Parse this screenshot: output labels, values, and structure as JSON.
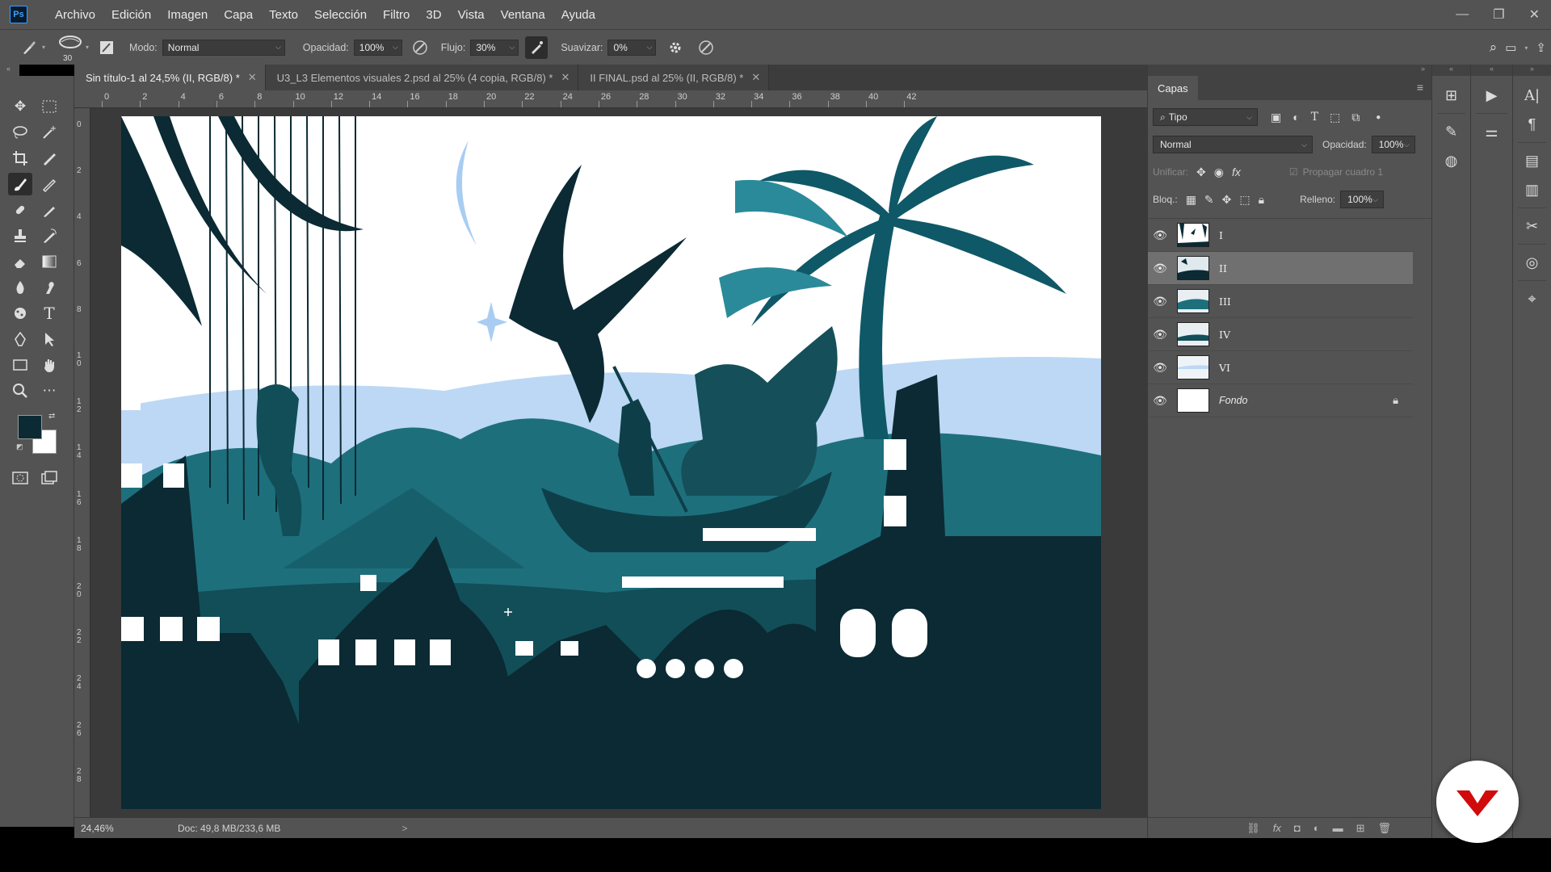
{
  "app": {
    "logo": "Ps"
  },
  "menu": [
    "Archivo",
    "Edición",
    "Imagen",
    "Capa",
    "Texto",
    "Selección",
    "Filtro",
    "3D",
    "Vista",
    "Ventana",
    "Ayuda"
  ],
  "options": {
    "brush_size": "30",
    "mode_label": "Modo:",
    "mode_value": "Normal",
    "opacity_label": "Opacidad:",
    "opacity_value": "100%",
    "flow_label": "Flujo:",
    "flow_value": "30%",
    "smooth_label": "Suavizar:",
    "smooth_value": "0%"
  },
  "tabs": [
    {
      "label": "Sin título-1 al 24,5% (II, RGB/8) *",
      "active": true
    },
    {
      "label": "U3_L3 Elementos visuales 2.psd al 25% (4 copia, RGB/8) *",
      "active": false
    },
    {
      "label": "II FINAL.psd al 25% (II, RGB/8) *",
      "active": false
    }
  ],
  "ruler_h": [
    "0",
    "2",
    "4",
    "6",
    "8",
    "10",
    "12",
    "14",
    "16",
    "18",
    "20",
    "22",
    "24",
    "26",
    "28",
    "30",
    "32",
    "34",
    "36",
    "38",
    "40",
    "42"
  ],
  "ruler_v": [
    "0",
    "2",
    "4",
    "6",
    "8",
    "10",
    "12",
    "14",
    "16",
    "18",
    "20",
    "22",
    "24",
    "26",
    "28"
  ],
  "status": {
    "zoom": "24,46%",
    "doc": "Doc: 49,8 MB/233,6 MB",
    "arrow": ">"
  },
  "layers_panel": {
    "tab": "Capas",
    "filter_kind": "Tipo",
    "blend_mode": "Normal",
    "opacity_label": "Opacidad:",
    "opacity_value": "100%",
    "unify_label": "Unificar:",
    "propagate_label": "Propagar cuadro 1",
    "lock_label": "Bloq.:",
    "fill_label": "Relleno:",
    "fill_value": "100%",
    "layers": [
      {
        "name": "I",
        "selected": false,
        "italic": false
      },
      {
        "name": "II",
        "selected": true,
        "italic": false
      },
      {
        "name": "III",
        "selected": false,
        "italic": false
      },
      {
        "name": "IV",
        "selected": false,
        "italic": false
      },
      {
        "name": "VI",
        "selected": false,
        "italic": false
      },
      {
        "name": "Fondo",
        "selected": false,
        "italic": true,
        "locked": true
      }
    ]
  },
  "colors": {
    "foreground": "#0b2a33",
    "background": "#ffffff",
    "ui": "#535353",
    "accent_brand": "#d10a0a"
  }
}
